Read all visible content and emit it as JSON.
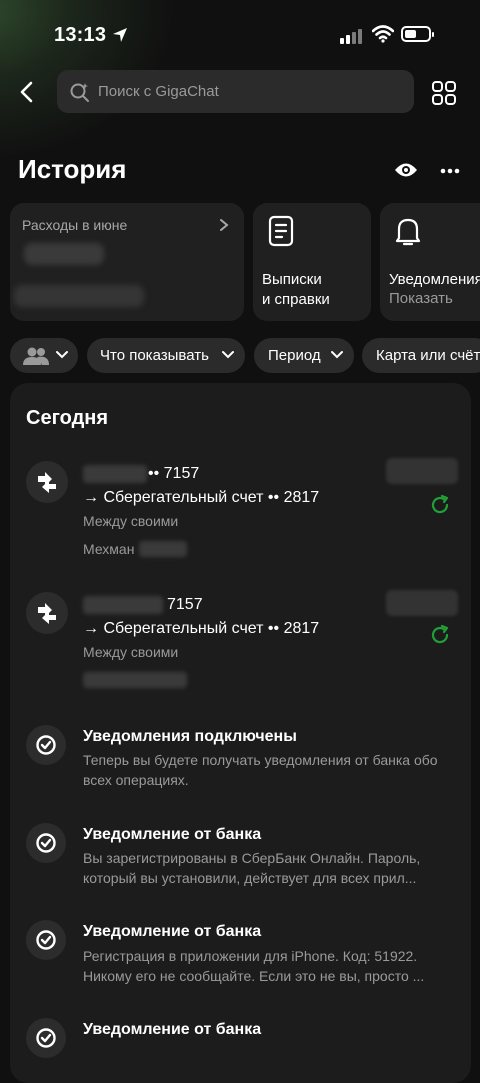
{
  "status_bar": {
    "time": "13:13"
  },
  "search": {
    "placeholder": "Поиск с GigaChat"
  },
  "page_title": "История",
  "cards": {
    "expenses": {
      "label": "Расходы в июне"
    },
    "statements": {
      "line1": "Выписки",
      "line2": "и справки"
    },
    "notifications": {
      "title": "Уведомления",
      "subtitle": "Показать"
    }
  },
  "filters": {
    "what_to_show": "Что показывать",
    "period": "Период",
    "card_or_account": "Карта или счёт"
  },
  "section": {
    "today": "Сегодня"
  },
  "transactions": [
    {
      "from_suffix": "•• 7157",
      "to": "→ Сберегательный счет •• 2817",
      "type": "Между своими",
      "person": "Мехман"
    },
    {
      "from_suffix": "7157",
      "to": "→ Сберегательный счет •• 2817",
      "type": "Между своими"
    }
  ],
  "notifications": [
    {
      "title": "Уведомления подключены",
      "body": "Теперь вы будете получать уведомления от банка обо всех операциях."
    },
    {
      "title": "Уведомление от банка",
      "line1": "Вы зарегистрированы в СберБанк Онлайн. Пароль,",
      "line2": "который вы установили, действует для всех прил..."
    },
    {
      "title": "Уведомление от банка",
      "line1": "Регистрация в приложении для iPhone. Код: 51922.",
      "line2": "Никому его не сообщайте. Если это не вы, просто ..."
    },
    {
      "title": "Уведомление от банка"
    }
  ],
  "colors": {
    "background": "#101010",
    "card": "#1f201f",
    "accent_green": "#21a038"
  }
}
